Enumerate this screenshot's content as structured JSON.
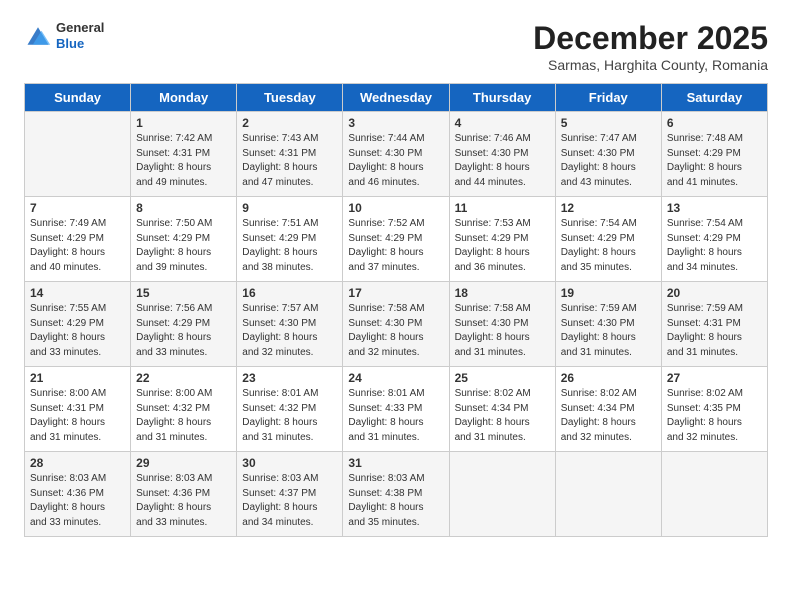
{
  "header": {
    "logo": {
      "general": "General",
      "blue": "Blue"
    },
    "month": "December 2025",
    "location": "Sarmas, Harghita County, Romania"
  },
  "days_of_week": [
    "Sunday",
    "Monday",
    "Tuesday",
    "Wednesday",
    "Thursday",
    "Friday",
    "Saturday"
  ],
  "weeks": [
    [
      {
        "day": "",
        "info": ""
      },
      {
        "day": "1",
        "info": "Sunrise: 7:42 AM\nSunset: 4:31 PM\nDaylight: 8 hours\nand 49 minutes."
      },
      {
        "day": "2",
        "info": "Sunrise: 7:43 AM\nSunset: 4:31 PM\nDaylight: 8 hours\nand 47 minutes."
      },
      {
        "day": "3",
        "info": "Sunrise: 7:44 AM\nSunset: 4:30 PM\nDaylight: 8 hours\nand 46 minutes."
      },
      {
        "day": "4",
        "info": "Sunrise: 7:46 AM\nSunset: 4:30 PM\nDaylight: 8 hours\nand 44 minutes."
      },
      {
        "day": "5",
        "info": "Sunrise: 7:47 AM\nSunset: 4:30 PM\nDaylight: 8 hours\nand 43 minutes."
      },
      {
        "day": "6",
        "info": "Sunrise: 7:48 AM\nSunset: 4:29 PM\nDaylight: 8 hours\nand 41 minutes."
      }
    ],
    [
      {
        "day": "7",
        "info": "Sunrise: 7:49 AM\nSunset: 4:29 PM\nDaylight: 8 hours\nand 40 minutes."
      },
      {
        "day": "8",
        "info": "Sunrise: 7:50 AM\nSunset: 4:29 PM\nDaylight: 8 hours\nand 39 minutes."
      },
      {
        "day": "9",
        "info": "Sunrise: 7:51 AM\nSunset: 4:29 PM\nDaylight: 8 hours\nand 38 minutes."
      },
      {
        "day": "10",
        "info": "Sunrise: 7:52 AM\nSunset: 4:29 PM\nDaylight: 8 hours\nand 37 minutes."
      },
      {
        "day": "11",
        "info": "Sunrise: 7:53 AM\nSunset: 4:29 PM\nDaylight: 8 hours\nand 36 minutes."
      },
      {
        "day": "12",
        "info": "Sunrise: 7:54 AM\nSunset: 4:29 PM\nDaylight: 8 hours\nand 35 minutes."
      },
      {
        "day": "13",
        "info": "Sunrise: 7:54 AM\nSunset: 4:29 PM\nDaylight: 8 hours\nand 34 minutes."
      }
    ],
    [
      {
        "day": "14",
        "info": "Sunrise: 7:55 AM\nSunset: 4:29 PM\nDaylight: 8 hours\nand 33 minutes."
      },
      {
        "day": "15",
        "info": "Sunrise: 7:56 AM\nSunset: 4:29 PM\nDaylight: 8 hours\nand 33 minutes."
      },
      {
        "day": "16",
        "info": "Sunrise: 7:57 AM\nSunset: 4:30 PM\nDaylight: 8 hours\nand 32 minutes."
      },
      {
        "day": "17",
        "info": "Sunrise: 7:58 AM\nSunset: 4:30 PM\nDaylight: 8 hours\nand 32 minutes."
      },
      {
        "day": "18",
        "info": "Sunrise: 7:58 AM\nSunset: 4:30 PM\nDaylight: 8 hours\nand 31 minutes."
      },
      {
        "day": "19",
        "info": "Sunrise: 7:59 AM\nSunset: 4:30 PM\nDaylight: 8 hours\nand 31 minutes."
      },
      {
        "day": "20",
        "info": "Sunrise: 7:59 AM\nSunset: 4:31 PM\nDaylight: 8 hours\nand 31 minutes."
      }
    ],
    [
      {
        "day": "21",
        "info": "Sunrise: 8:00 AM\nSunset: 4:31 PM\nDaylight: 8 hours\nand 31 minutes."
      },
      {
        "day": "22",
        "info": "Sunrise: 8:00 AM\nSunset: 4:32 PM\nDaylight: 8 hours\nand 31 minutes."
      },
      {
        "day": "23",
        "info": "Sunrise: 8:01 AM\nSunset: 4:32 PM\nDaylight: 8 hours\nand 31 minutes."
      },
      {
        "day": "24",
        "info": "Sunrise: 8:01 AM\nSunset: 4:33 PM\nDaylight: 8 hours\nand 31 minutes."
      },
      {
        "day": "25",
        "info": "Sunrise: 8:02 AM\nSunset: 4:34 PM\nDaylight: 8 hours\nand 31 minutes."
      },
      {
        "day": "26",
        "info": "Sunrise: 8:02 AM\nSunset: 4:34 PM\nDaylight: 8 hours\nand 32 minutes."
      },
      {
        "day": "27",
        "info": "Sunrise: 8:02 AM\nSunset: 4:35 PM\nDaylight: 8 hours\nand 32 minutes."
      }
    ],
    [
      {
        "day": "28",
        "info": "Sunrise: 8:03 AM\nSunset: 4:36 PM\nDaylight: 8 hours\nand 33 minutes."
      },
      {
        "day": "29",
        "info": "Sunrise: 8:03 AM\nSunset: 4:36 PM\nDaylight: 8 hours\nand 33 minutes."
      },
      {
        "day": "30",
        "info": "Sunrise: 8:03 AM\nSunset: 4:37 PM\nDaylight: 8 hours\nand 34 minutes."
      },
      {
        "day": "31",
        "info": "Sunrise: 8:03 AM\nSunset: 4:38 PM\nDaylight: 8 hours\nand 35 minutes."
      },
      {
        "day": "",
        "info": ""
      },
      {
        "day": "",
        "info": ""
      },
      {
        "day": "",
        "info": ""
      }
    ]
  ]
}
